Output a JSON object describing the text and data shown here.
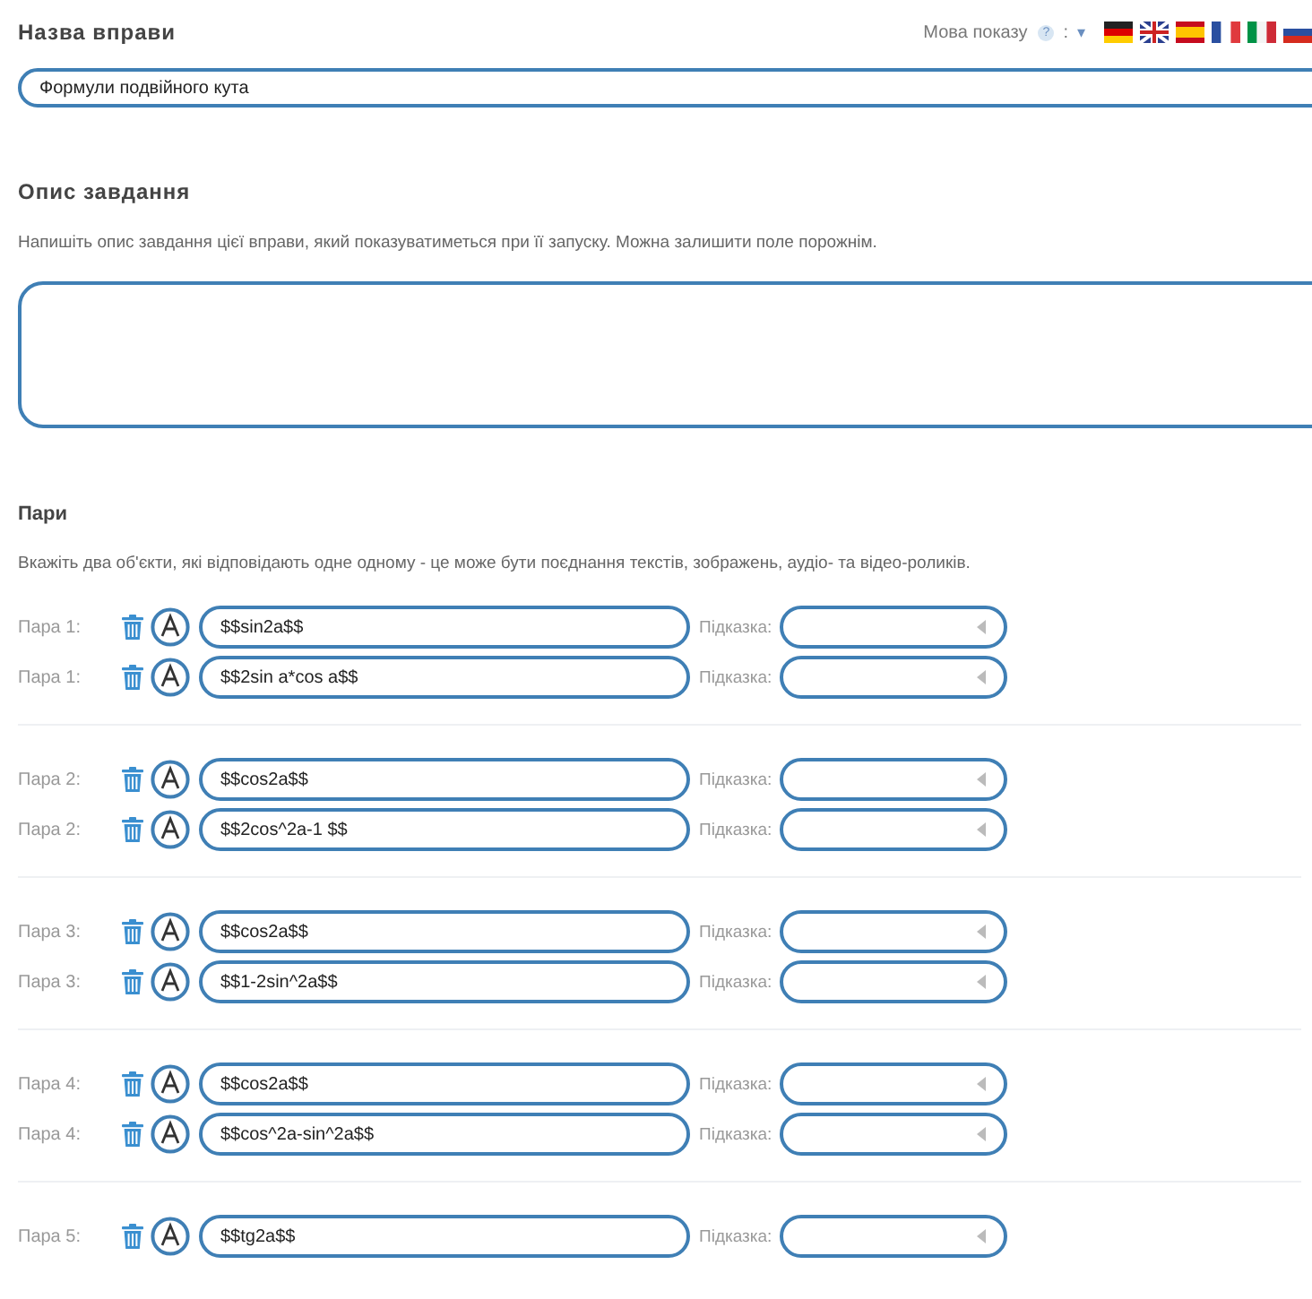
{
  "title_section": {
    "heading": "Назва вправи",
    "language": {
      "label": "Мова показу",
      "help": "?",
      "separator": ":",
      "dropdown": "▾"
    },
    "value": "Формули подвійного кута"
  },
  "description_section": {
    "heading": "Опис завдання",
    "hint": "Напишіть опис завдання цієї вправи, який показуватиметься при її запуску. Можна залишити поле порожнім."
  },
  "pairs_section": {
    "heading": "Пари",
    "hint": "Вкажіть два об'єкти, які відповідають одне одному - це може бути поєднання текстів, зображень, аудіо- та відео-роликів.",
    "groups": [
      {
        "rows": [
          {
            "label": "Пара 1:",
            "value": "$$sin2a$$",
            "hint_label": "Підказка:"
          },
          {
            "label": "Пара 1:",
            "value": "$$2sin a*cos a$$",
            "hint_label": "Підказка:"
          }
        ]
      },
      {
        "rows": [
          {
            "label": "Пара 2:",
            "value": "$$cos2a$$",
            "hint_label": "Підказка:"
          },
          {
            "label": "Пара 2:",
            "value": "$$2cos^2a-1 $$",
            "hint_label": "Підказка:"
          }
        ]
      },
      {
        "rows": [
          {
            "label": "Пара 3:",
            "value": "$$cos2a$$",
            "hint_label": "Підказка:"
          },
          {
            "label": "Пара 3:",
            "value": "$$1-2sin^2a$$",
            "hint_label": "Підказка:"
          }
        ]
      },
      {
        "rows": [
          {
            "label": "Пара 4:",
            "value": "$$cos2a$$",
            "hint_label": "Підказка:"
          },
          {
            "label": "Пара 4:",
            "value": "$$cos^2a-sin^2a$$",
            "hint_label": "Підказка:"
          }
        ]
      },
      {
        "rows": [
          {
            "label": "Пара 5:",
            "value": "$$tg2a$$",
            "hint_label": "Підказка:"
          }
        ]
      }
    ]
  }
}
